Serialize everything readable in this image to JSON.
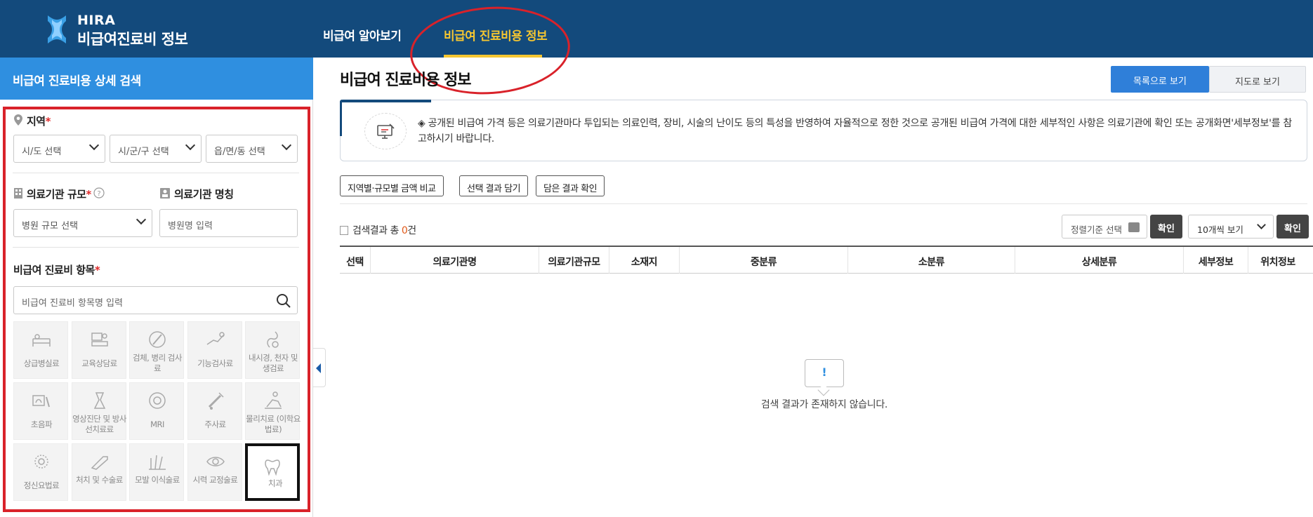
{
  "header": {
    "logo_title": "HIRA",
    "logo_subtitle": "비급여진료비 정보",
    "nav": [
      {
        "label": "비급여 알아보기"
      },
      {
        "label": "비급여 진료비용 정보"
      }
    ],
    "accent_color": "#f5c631",
    "bg_color": "#134a7c"
  },
  "sidebar": {
    "title": "비급여 진료비용 상세 검색",
    "region": {
      "label": "지역",
      "required_mark": "*",
      "selects": [
        "시/도 선택",
        "시/군/구 선택",
        "읍/면/동 선택"
      ]
    },
    "scale": {
      "label": "의료기관 규모",
      "required_mark": "*",
      "select": "병원 규모 선택"
    },
    "name": {
      "label": "의료기관 명칭",
      "placeholder": "병원명 입력"
    },
    "items": {
      "label": "비급여 진료비 항목",
      "required_mark": "*",
      "search_placeholder": "비급여 진료비 항목명 입력",
      "categories": [
        {
          "label": "상급병실료",
          "icon": "bed-icon"
        },
        {
          "label": "교육상담료",
          "icon": "counseling-icon"
        },
        {
          "label": "검체, 병리 검사료",
          "icon": "lab-test-icon"
        },
        {
          "label": "기능검사료",
          "icon": "function-test-icon"
        },
        {
          "label": "내시경, 천자 및 생검료",
          "icon": "endoscope-icon"
        },
        {
          "label": "초음파",
          "icon": "ultrasound-icon"
        },
        {
          "label": "영상진단 및 방사선치료료",
          "icon": "radiology-icon"
        },
        {
          "label": "MRI",
          "icon": "mri-icon"
        },
        {
          "label": "주사료",
          "icon": "syringe-icon"
        },
        {
          "label": "물리치료 (이학요법료)",
          "icon": "physio-icon"
        },
        {
          "label": "정신요법료",
          "icon": "brain-icon"
        },
        {
          "label": "처치 및 수술료",
          "icon": "surgery-icon"
        },
        {
          "label": "모발 이식술료",
          "icon": "hair-icon"
        },
        {
          "label": "시력 교정술료",
          "icon": "eye-icon"
        },
        {
          "label": "치과",
          "icon": "tooth-icon"
        }
      ]
    }
  },
  "main": {
    "title": "비급여 진료비용 정보",
    "view_list": "목록으로 보기",
    "view_map": "지도로 보기",
    "notice": "◈ 공개된 비급여 가격 등은 의료기관마다 투입되는 의료인력, 장비, 시술의 난이도 등의 특성을 반영하여 자율적으로 정한 것으로 공개된 비급여 가격에 대한 세부적인 사항은 의료기관에 확인 또는 공개화면'세부정보'를 참고하시기 바랍니다.",
    "actions": [
      "지역별·규모별 금액 비교",
      "선택 결과 담기",
      "담은 결과 확인"
    ],
    "result_prefix": "검색결과 총 ",
    "result_count": "0",
    "result_suffix": "건",
    "sort_placeholder": "정렬기준 선택",
    "confirm": "확인",
    "page_size": "10개씩 보기",
    "columns": [
      "선택",
      "의료기관명",
      "의료기관규모",
      "소재지",
      "중분류",
      "소분류",
      "상세분류",
      "세부정보",
      "위치정보"
    ],
    "empty_mark": "!",
    "empty_message": "검색 결과가 존재하지 않습니다."
  }
}
